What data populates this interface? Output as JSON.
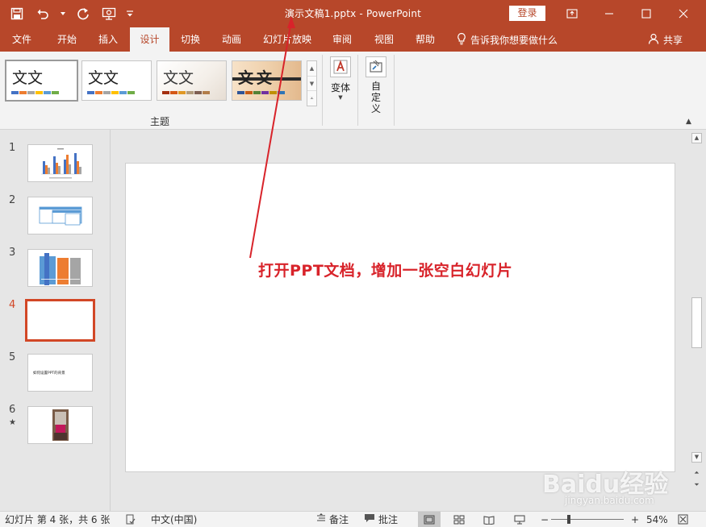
{
  "window": {
    "title": "演示文稿1.pptx  -  PowerPoint",
    "login_label": "登录"
  },
  "qat": {
    "icons": [
      "save-icon",
      "undo-icon",
      "undo-dropdown-icon",
      "redo-icon",
      "present-from-start-icon",
      "customize-qat-icon"
    ]
  },
  "tabs": [
    {
      "label": "文件"
    },
    {
      "label": "开始"
    },
    {
      "label": "插入"
    },
    {
      "label": "设计"
    },
    {
      "label": "切换"
    },
    {
      "label": "动画"
    },
    {
      "label": "幻灯片放映"
    },
    {
      "label": "审阅"
    },
    {
      "label": "视图"
    },
    {
      "label": "帮助"
    }
  ],
  "active_tab": "设计",
  "tell_me": "告诉我你想要做什么",
  "share": "共享",
  "ribbon": {
    "themes": [
      {
        "sample": "文文",
        "colors": [
          "#4472c4",
          "#ed7d31",
          "#a5a5a5",
          "#ffc000",
          "#5b9bd5",
          "#70ad47"
        ]
      },
      {
        "sample": "文文",
        "colors": [
          "#4472c4",
          "#ed7d31",
          "#a5a5a5",
          "#ffc000",
          "#5b9bd5",
          "#70ad47"
        ]
      },
      {
        "sample": "文文",
        "colors": [
          "#a5300f",
          "#d55816",
          "#e19825",
          "#b19c7d",
          "#7f5f52",
          "#b27d49"
        ]
      },
      {
        "sample": "文文",
        "colors": [
          "#2f5597",
          "#c55a11",
          "#548235",
          "#7030a0",
          "#bf9000",
          "#2e75b6"
        ]
      }
    ],
    "themes_group_label": "主题",
    "variants_label": "变体",
    "customize_label": "自定义"
  },
  "slides": [
    {
      "number": "1"
    },
    {
      "number": "2"
    },
    {
      "number": "3"
    },
    {
      "number": "4"
    },
    {
      "number": "5",
      "text": "如何设置PPT的背景"
    },
    {
      "number": "6",
      "marker": "★"
    }
  ],
  "current_slide": 4,
  "annotation": "打开PPT文档，增加一张空白幻灯片",
  "watermark": {
    "logo": "Baidu经验",
    "url": "jingyan.baidu.com"
  },
  "status": {
    "slide_info": "幻灯片 第 4 张，共 6 张",
    "language": "中文(中国)",
    "notes": "备注",
    "comments": "批注",
    "zoom": "54%"
  },
  "colors": {
    "accent": "#b7472a",
    "current_slide_border": "#d24726",
    "annotation": "#d8232a"
  }
}
